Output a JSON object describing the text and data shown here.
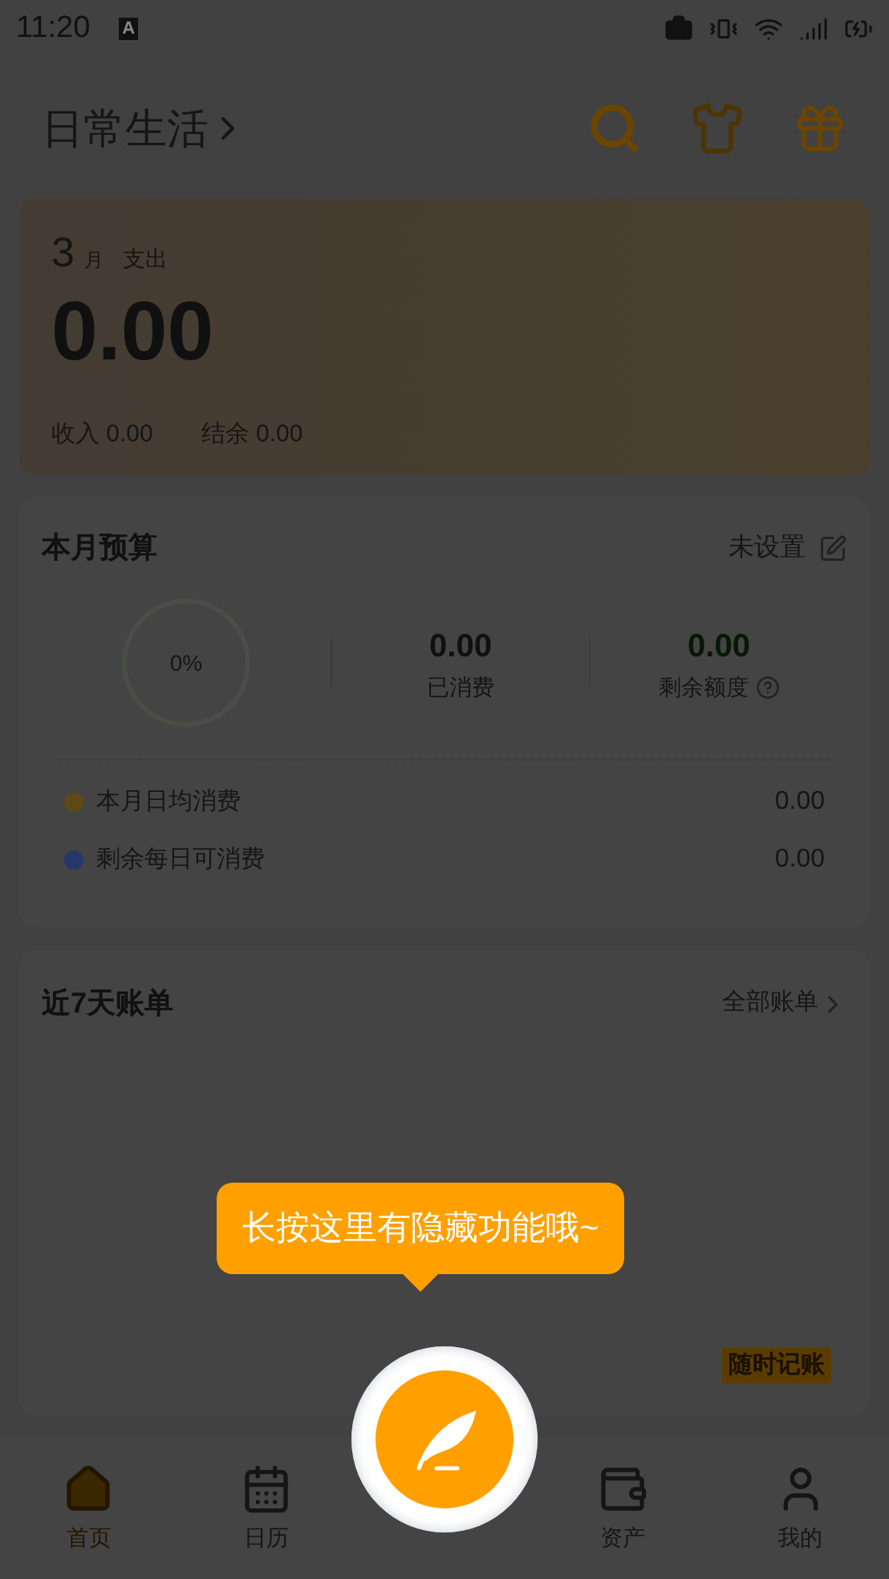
{
  "status_bar": {
    "time": "11:20",
    "keyboard": "A"
  },
  "header": {
    "title": "日常生活"
  },
  "summary": {
    "month": "3",
    "month_unit": "月",
    "label": "支出",
    "amount": "0.00",
    "income_label": "收入",
    "income": "0.00",
    "balance_label": "结余",
    "balance": "0.00"
  },
  "budget": {
    "title": "本月预算",
    "action": "未设置",
    "percent": "0%",
    "spent_value": "0.00",
    "spent_label": "已消费",
    "remaining_value": "0.00",
    "remaining_label": "剩余额度",
    "rows": [
      {
        "label": "本月日均消费",
        "value": "0.00",
        "color": "#5e4a14"
      },
      {
        "label": "剩余每日可消费",
        "value": "0.00",
        "color": "#24386a"
      }
    ]
  },
  "bills": {
    "title": "近7天账单",
    "action": "全部账单",
    "button": "随时记账"
  },
  "nav": [
    {
      "label": "首页",
      "selected": true
    },
    {
      "label": "日历",
      "selected": false
    },
    {
      "label": "资产",
      "selected": false
    },
    {
      "label": "我的",
      "selected": false
    }
  ],
  "tooltip": {
    "text": "长按这里有隐藏功能哦~"
  }
}
